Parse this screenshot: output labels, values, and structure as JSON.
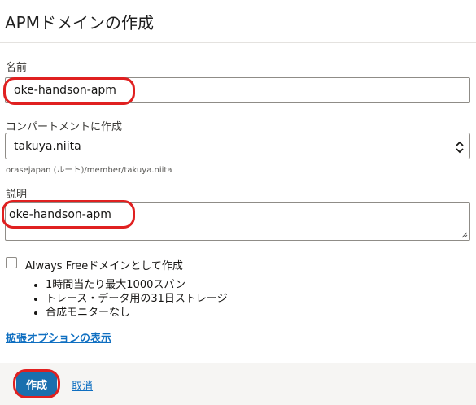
{
  "dialog": {
    "title": "APMドメインの作成"
  },
  "form": {
    "name": {
      "label": "名前",
      "value": "oke-handson-apm"
    },
    "compartment": {
      "label": "コンパートメントに作成",
      "value": "takuya.niita",
      "hint": "orasejapan (ルート)/member/takuya.niita"
    },
    "description": {
      "label": "説明",
      "value": "oke-handson-apm"
    },
    "always_free": {
      "label": "Always Freeドメインとして作成",
      "checked": false,
      "features": [
        "1時間当たり最大1000スパン",
        "トレース・データ用の31日ストレージ",
        "合成モニターなし"
      ]
    },
    "advanced_link": "拡張オプションの表示"
  },
  "footer": {
    "create_label": "作成",
    "cancel_label": "取消"
  },
  "colors": {
    "primary_button": "#1a6fae",
    "link": "#0f6fc1",
    "highlight_annotation": "#e02020"
  }
}
